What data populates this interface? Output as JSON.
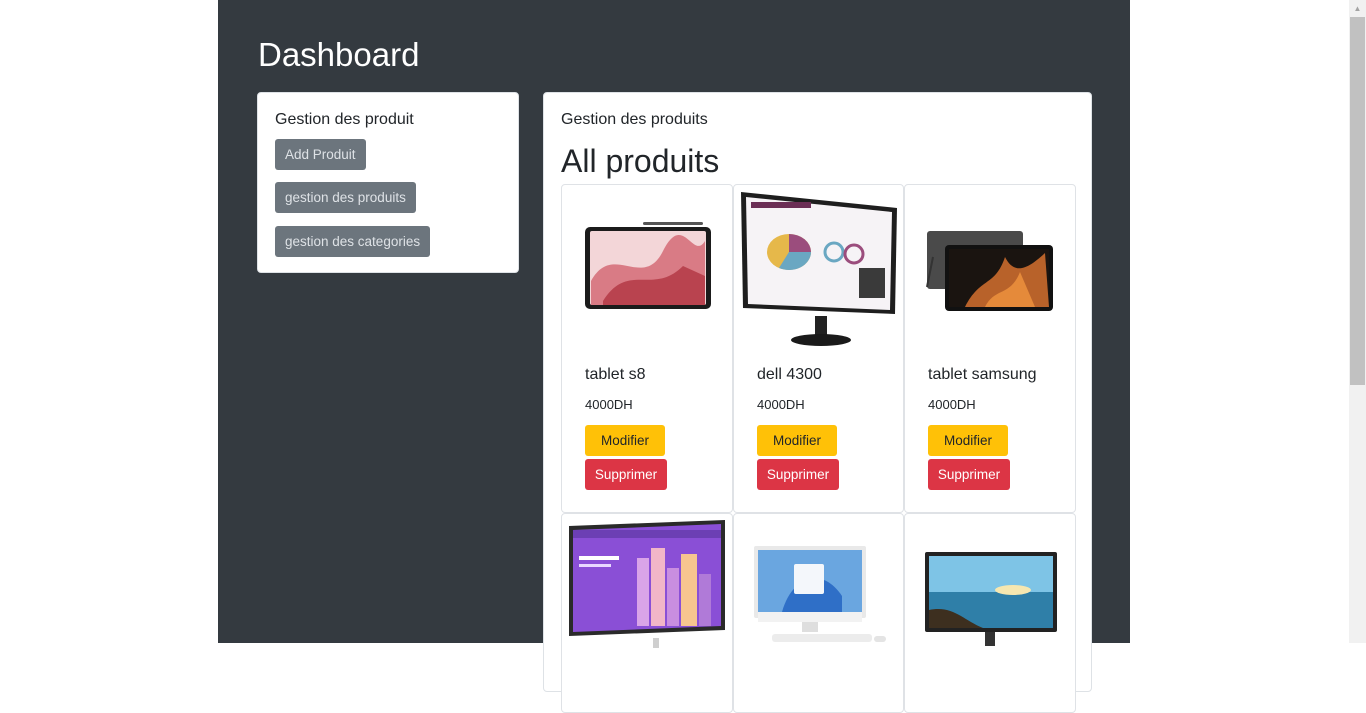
{
  "page": {
    "title": "Dashboard"
  },
  "left_panel": {
    "heading": "Gestion des produit",
    "buttons": [
      "Add Produit",
      "gestion des produits",
      "gestion des categories"
    ]
  },
  "right_panel": {
    "heading": "Gestion des produits",
    "subheading": "All produits"
  },
  "products": [
    {
      "name": "tablet s8",
      "price": "4000DH",
      "edit": "Modifier",
      "delete": "Supprimer",
      "image": "tablet-image"
    },
    {
      "name": "dell 4300",
      "price": "4000DH",
      "edit": "Modifier",
      "delete": "Supprimer",
      "image": "monitor-image"
    },
    {
      "name": "tablet samsung",
      "price": "4000DH",
      "edit": "Modifier",
      "delete": "Supprimer",
      "image": "tablet-image"
    },
    {
      "image": "monitor-image"
    },
    {
      "image": "all-in-one-pc-image"
    },
    {
      "image": "monitor-image"
    }
  ],
  "colors": {
    "background": "#343a40",
    "secondary": "#6c757d",
    "warning": "#ffc107",
    "danger": "#dc3545"
  }
}
